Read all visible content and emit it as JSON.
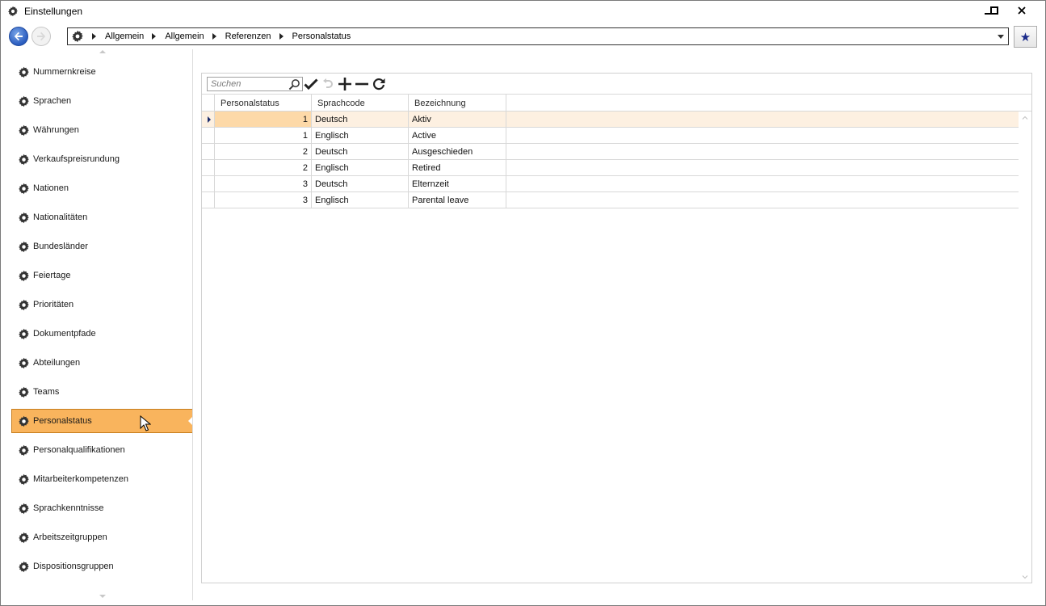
{
  "window": {
    "title": "Einstellungen",
    "minimize_icon": "minimize-icon",
    "maximize_icon": "maximize-icon",
    "close_icon": "close-icon"
  },
  "nav": {
    "back_icon": "back-arrow-icon",
    "forward_icon": "forward-arrow-icon",
    "breadcrumb": [
      "Allgemein",
      "Allgemein",
      "Referenzen",
      "Personalstatus"
    ],
    "favorite_icon": "star-icon"
  },
  "sidebar": {
    "items": [
      {
        "label": "Nummernkreise"
      },
      {
        "label": "Sprachen"
      },
      {
        "label": "Währungen"
      },
      {
        "label": "Verkaufspreisrundung"
      },
      {
        "label": "Nationen"
      },
      {
        "label": "Nationalitäten"
      },
      {
        "label": "Bundesländer"
      },
      {
        "label": "Feiertage"
      },
      {
        "label": "Prioritäten"
      },
      {
        "label": "Dokumentpfade"
      },
      {
        "label": "Abteilungen"
      },
      {
        "label": "Teams"
      },
      {
        "label": "Personalstatus"
      },
      {
        "label": "Personalqualifikationen"
      },
      {
        "label": "Mitarbeiterkompetenzen"
      },
      {
        "label": "Sprachkenntnisse"
      },
      {
        "label": "Arbeitszeitgruppen"
      },
      {
        "label": "Dispositionsgruppen"
      }
    ],
    "active_index": 12
  },
  "toolbar": {
    "search_placeholder": "Suchen"
  },
  "grid": {
    "columns": [
      "Personalstatus",
      "Sprachcode",
      "Bezeichnung"
    ],
    "rows": [
      [
        "1",
        "Deutsch",
        "Aktiv"
      ],
      [
        "1",
        "Englisch",
        "Active"
      ],
      [
        "2",
        "Deutsch",
        "Ausgeschieden"
      ],
      [
        "2",
        "Englisch",
        "Retired"
      ],
      [
        "3",
        "Deutsch",
        "Elternzeit"
      ],
      [
        "3",
        "Englisch",
        "Parental leave"
      ]
    ],
    "selected_row": 0
  },
  "colors": {
    "accent": "#f9b45d",
    "selected_row": "#fdf0e1",
    "selected_cell": "#fdd9a8"
  }
}
